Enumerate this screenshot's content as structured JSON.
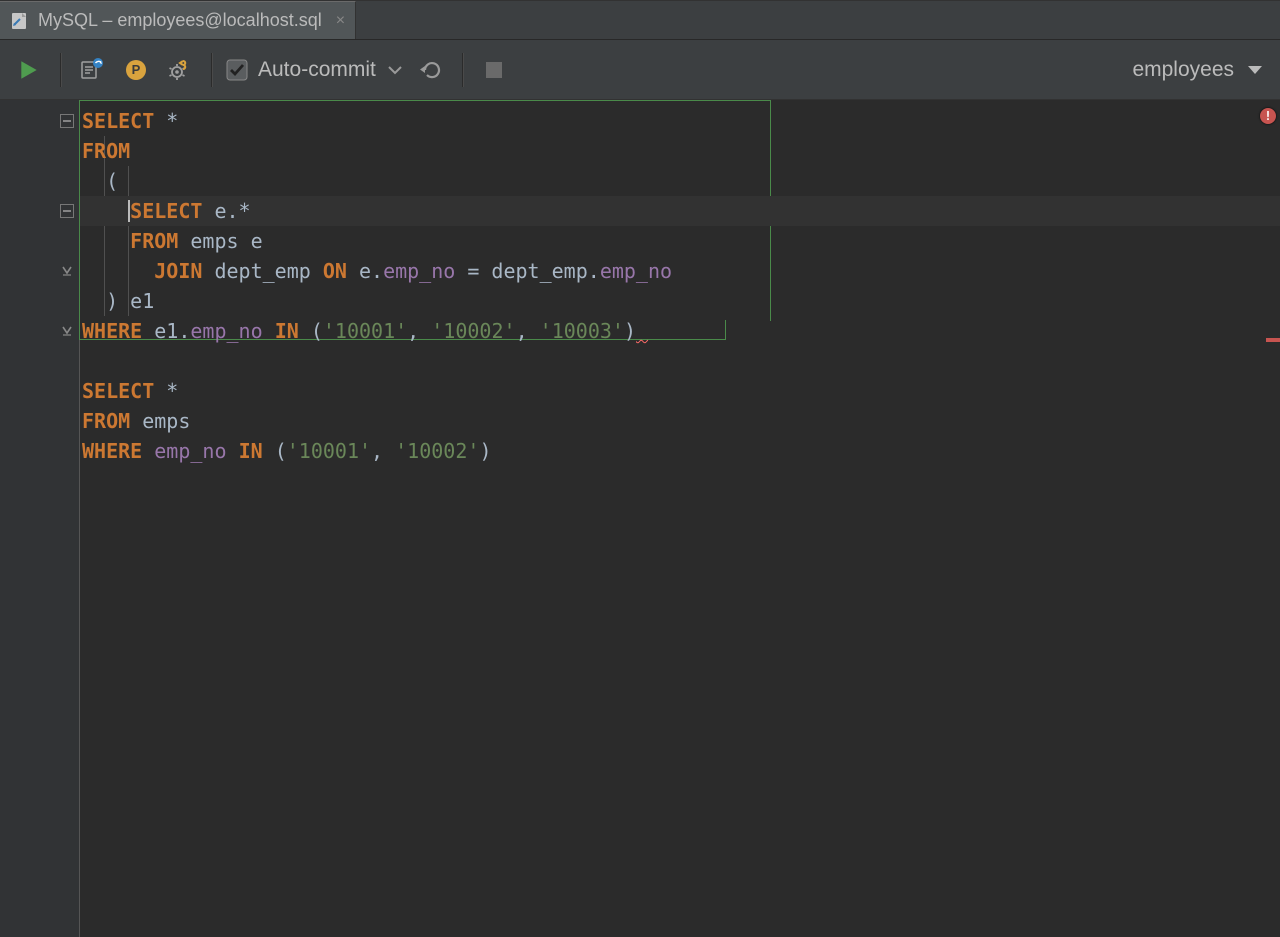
{
  "tab": {
    "title": "MySQL – employees@localhost.sql",
    "close_label": "×"
  },
  "toolbar": {
    "auto_commit_label": "Auto-commit",
    "schema_label": "employees"
  },
  "code": {
    "lines": [
      {
        "t": [
          {
            "c": "kw",
            "s": "SELECT"
          },
          {
            "c": "op",
            "s": " "
          },
          {
            "c": "star",
            "s": "*"
          }
        ]
      },
      {
        "t": [
          {
            "c": "kw",
            "s": "FROM"
          }
        ]
      },
      {
        "t": [
          {
            "c": "op",
            "s": "  ("
          }
        ],
        "sub_indent": 2
      },
      {
        "t": [
          {
            "c": "op",
            "s": "    "
          },
          {
            "c": "kw",
            "s": "SELECT"
          },
          {
            "c": "op",
            "s": " e."
          },
          {
            "c": "star",
            "s": "*"
          }
        ],
        "caret_at": 4,
        "highlight": true
      },
      {
        "t": [
          {
            "c": "op",
            "s": "    "
          },
          {
            "c": "kw",
            "s": "FROM"
          },
          {
            "c": "op",
            "s": " emps e"
          }
        ]
      },
      {
        "t": [
          {
            "c": "op",
            "s": "      "
          },
          {
            "c": "kw",
            "s": "JOIN"
          },
          {
            "c": "op",
            "s": " dept_emp "
          },
          {
            "c": "kw",
            "s": "ON"
          },
          {
            "c": "op",
            "s": " e."
          },
          {
            "c": "pale",
            "s": "emp_no"
          },
          {
            "c": "op",
            "s": " = dept_emp."
          },
          {
            "c": "pale",
            "s": "emp_no"
          }
        ]
      },
      {
        "t": [
          {
            "c": "op",
            "s": "  ) e1"
          }
        ]
      },
      {
        "t": [
          {
            "c": "kw",
            "s": "WHERE"
          },
          {
            "c": "op",
            "s": " e1."
          },
          {
            "c": "pale",
            "s": "emp_no"
          },
          {
            "c": "op",
            "s": " "
          },
          {
            "c": "kw",
            "s": "IN"
          },
          {
            "c": "op",
            "s": " ("
          },
          {
            "c": "str",
            "s": "'10001'"
          },
          {
            "c": "op",
            "s": ", "
          },
          {
            "c": "str",
            "s": "'10002'"
          },
          {
            "c": "op",
            "s": ", "
          },
          {
            "c": "str",
            "s": "'10003'"
          },
          {
            "c": "op",
            "s": ")"
          }
        ],
        "squiggle_tail": true
      },
      {
        "t": []
      },
      {
        "t": [
          {
            "c": "kw",
            "s": "SELECT"
          },
          {
            "c": "op",
            "s": " "
          },
          {
            "c": "star",
            "s": "*"
          }
        ]
      },
      {
        "t": [
          {
            "c": "kw",
            "s": "FROM"
          },
          {
            "c": "op",
            "s": " emps"
          }
        ]
      },
      {
        "t": [
          {
            "c": "kw",
            "s": "WHERE"
          },
          {
            "c": "op",
            "s": " "
          },
          {
            "c": "pale",
            "s": "emp_no"
          },
          {
            "c": "op",
            "s": " "
          },
          {
            "c": "kw",
            "s": "IN"
          },
          {
            "c": "op",
            "s": " ("
          },
          {
            "c": "str",
            "s": "'10001'"
          },
          {
            "c": "op",
            "s": ", "
          },
          {
            "c": "str",
            "s": "'10002'"
          },
          {
            "c": "op",
            "s": ")"
          }
        ]
      }
    ],
    "folds": [
      {
        "line": 0,
        "kind": "open"
      },
      {
        "line": 3,
        "kind": "open"
      },
      {
        "line": 5,
        "kind": "close"
      },
      {
        "line": 7,
        "kind": "close"
      }
    ]
  }
}
